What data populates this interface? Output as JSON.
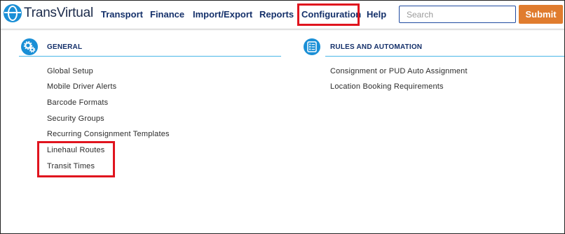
{
  "header": {
    "brand": "TransVirtual",
    "nav": [
      {
        "label": "Transport"
      },
      {
        "label": "Finance"
      },
      {
        "label": "Import/Export"
      },
      {
        "label": "Reports"
      },
      {
        "label": "Configuration",
        "highlighted": true
      },
      {
        "label": "Help"
      }
    ],
    "search_placeholder": "Search",
    "submit_label": "Submit"
  },
  "sections": {
    "general": {
      "title": "GENERAL",
      "icon": "gears-icon",
      "links": [
        "Global Setup",
        "Mobile Driver Alerts",
        "Barcode Formats",
        "Security Groups",
        "Recurring Consignment Templates",
        "Linehaul Routes",
        "Transit Times"
      ],
      "highlighted_links": [
        "Linehaul Routes",
        "Transit Times"
      ]
    },
    "rules": {
      "title": "RULES AND AUTOMATION",
      "icon": "checklist-icon",
      "links": [
        "Consignment or PUD Auto Assignment",
        "Location Booking Requirements"
      ]
    }
  },
  "colors": {
    "brand_blue": "#1a8fd6",
    "nav_text": "#14306a",
    "submit_orange": "#e07c2e",
    "highlight_red": "#e0141e",
    "divider": "#49b7e8"
  }
}
